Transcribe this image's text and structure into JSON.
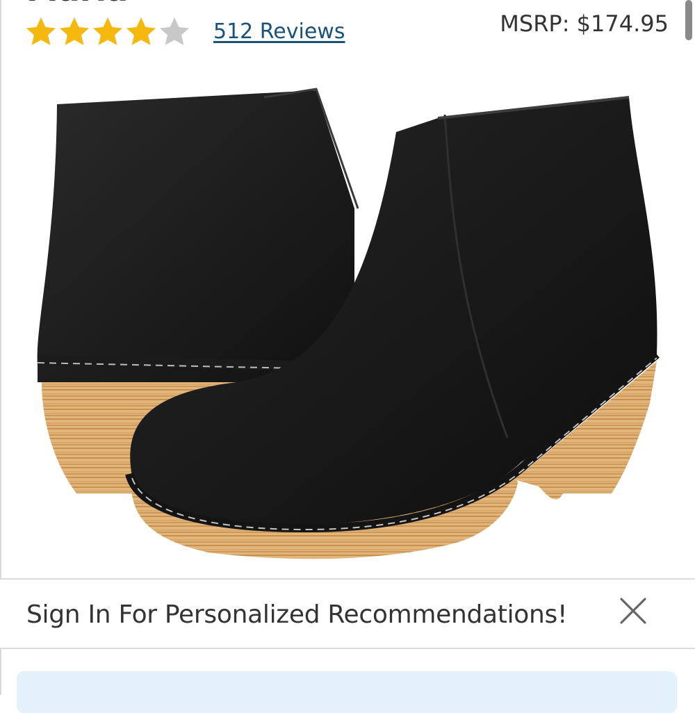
{
  "product": {
    "name": "Maria",
    "rating_value": 4,
    "rating_max": 5,
    "reviews_label": "512 Reviews",
    "msrp_label": "MSRP: $174.95"
  },
  "image": {
    "icon": "black-ankle-boots-wood-heel"
  },
  "banner": {
    "text": "Sign In For Personalized Recommendations!",
    "close_icon": "close-icon"
  },
  "colors": {
    "star_filled": "#f5b80f",
    "star_empty": "#c8c8c8",
    "link": "#1a5279",
    "panel": "#e3f1fb"
  }
}
